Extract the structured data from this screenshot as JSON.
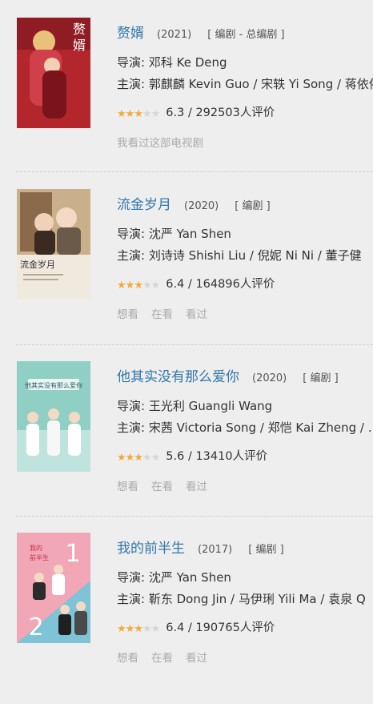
{
  "labels": {
    "director": "导演:",
    "cast": "主演:",
    "sep": " / ",
    "rating_suffix": "人评价"
  },
  "items": [
    {
      "title": "赘婿",
      "year": "(2021)",
      "role": "[ 编剧 - 总编剧 ]",
      "director": "邓科 Ke Deng",
      "cast": [
        "郭麒麟 Kevin Guo",
        "宋轶 Yi Song",
        "蒋依依"
      ],
      "score": "6.3",
      "votes": "292503",
      "stars": 3,
      "status": [
        "我看过这部电视剧"
      ],
      "poster": {
        "bg": "#b3262b",
        "accent": "#e8c27a",
        "text": "赘婿"
      }
    },
    {
      "title": "流金岁月",
      "year": "(2020)",
      "role": "[ 编剧 ]",
      "director": "沈严 Yan Shen",
      "cast": [
        "刘诗诗 Shishi Liu",
        "倪妮 Ni Ni",
        "董子健"
      ],
      "score": "6.4",
      "votes": "164896",
      "stars": 3,
      "status": [
        "想看",
        "在看",
        "看过"
      ],
      "poster": {
        "bg": "#efe9de",
        "accent": "#c7a46a",
        "text": "流金岁月"
      }
    },
    {
      "title": "他其实没有那么爱你",
      "year": "(2020)",
      "role": "[ 编剧 ]",
      "director": "王光利 Guangli Wang",
      "cast": [
        "宋茜 Victoria Song",
        "郑恺 Kai Zheng",
        "…"
      ],
      "score": "5.6",
      "votes": "13410",
      "stars": 3,
      "status": [
        "想看",
        "在看",
        "看过"
      ],
      "poster": {
        "bg": "#8fcfc4",
        "accent": "#ffffff",
        "text": "他其实没有那么爱你"
      }
    },
    {
      "title": "我的前半生",
      "year": "(2017)",
      "role": "[ 编剧 ]",
      "director": "沈严 Yan Shen",
      "cast": [
        "靳东 Dong Jin",
        "马伊琍 Yili Ma",
        "袁泉 Q"
      ],
      "score": "6.4",
      "votes": "190765",
      "stars": 3,
      "status": [
        "想看",
        "在看",
        "看过"
      ],
      "poster": {
        "bg": "#f2a7b7",
        "accent": "#7ec3d6",
        "text": "我的前半生"
      }
    }
  ]
}
